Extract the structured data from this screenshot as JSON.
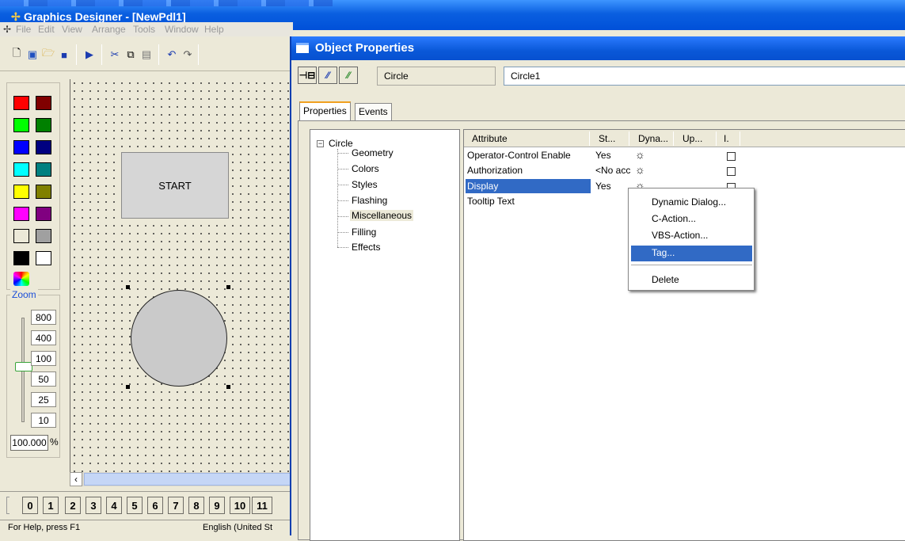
{
  "main_window": {
    "title": "Graphics Designer - [NewPdl1]",
    "menu": [
      "File",
      "Edit",
      "View",
      "Arrange",
      "Tools",
      "Window",
      "Help"
    ],
    "start_button_label": "START",
    "zoom": {
      "title": "Zoom",
      "levels": [
        "800",
        "400",
        "100",
        "50",
        "25",
        "10"
      ],
      "value": "100.000",
      "unit": "%"
    },
    "layers": [
      "0",
      "1",
      "2",
      "3",
      "4",
      "5",
      "6",
      "7",
      "8",
      "9",
      "10",
      "11"
    ],
    "status": {
      "help": "For Help, press F1",
      "language": "English (United St"
    },
    "palette_colors": [
      "#ff0000",
      "#800000",
      "#00ff00",
      "#008000",
      "#0000ff",
      "#000080",
      "#00ffff",
      "#008080",
      "#ffff00",
      "#808000",
      "#ff00ff",
      "#800080",
      "#ece9d8",
      "#a0a0a0",
      "#000000",
      "#ffffff"
    ]
  },
  "dialog": {
    "title": "Object Properties",
    "object_type": "Circle",
    "object_name": "Circle1",
    "tabs": [
      "Properties",
      "Events"
    ],
    "tree": {
      "root": "Circle",
      "nodes": [
        "Geometry",
        "Colors",
        "Styles",
        "Flashing",
        "Miscellaneous",
        "Filling",
        "Effects"
      ],
      "selected": "Miscellaneous"
    },
    "grid": {
      "headers": [
        "Attribute",
        "St...",
        "Dyna...",
        "Up...",
        "I."
      ],
      "rows": [
        {
          "attribute": "Operator-Control Enable",
          "static": "Yes"
        },
        {
          "attribute": "Authorization",
          "static": "<No acc"
        },
        {
          "attribute": "Display",
          "static": "Yes"
        },
        {
          "attribute": "Tooltip Text",
          "static": ""
        }
      ],
      "selected_row": "Display"
    },
    "context_menu": {
      "items": [
        "Dynamic Dialog...",
        "C-Action...",
        "VBS-Action...",
        "Tag...",
        "Delete"
      ],
      "highlighted": "Tag..."
    }
  }
}
